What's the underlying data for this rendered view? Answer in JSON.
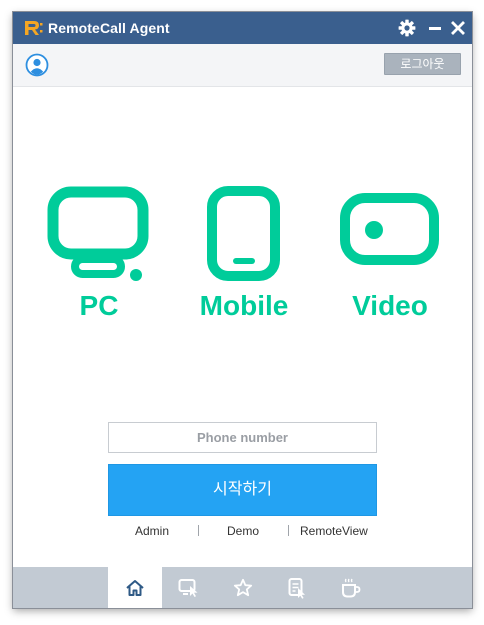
{
  "window": {
    "title": "RemoteCall Agent"
  },
  "toolbar": {
    "logout_label": "로그아웃"
  },
  "modes": [
    {
      "label": "PC"
    },
    {
      "label": "Mobile"
    },
    {
      "label": "Video"
    }
  ],
  "phone": {
    "placeholder": "Phone number",
    "value": ""
  },
  "start": {
    "label": "시작하기"
  },
  "links": [
    {
      "label": "Admin"
    },
    {
      "label": "Demo"
    },
    {
      "label": "RemoteView"
    }
  ],
  "bottom_nav": [
    {
      "icon": "home-icon",
      "active": true
    },
    {
      "icon": "remote-screen-icon",
      "active": false
    },
    {
      "icon": "star-icon",
      "active": false
    },
    {
      "icon": "document-icon",
      "active": false
    },
    {
      "icon": "coffee-cup-icon",
      "active": false
    }
  ],
  "colors": {
    "titlebar": "#3a5f8e",
    "accent_green": "#00cc9a",
    "start_button": "#24a3f3",
    "bottom_bar": "#c2cad3",
    "logo_orange": "#f5a623"
  }
}
